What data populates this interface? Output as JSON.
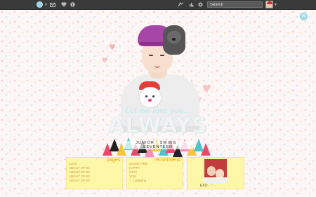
{
  "topbar": {
    "search_placeholder": "Search",
    "icons": [
      "dashboard-logo",
      "mail-icon",
      "heart-icon",
      "info-icon",
      "add-post-icon",
      "settings-icon",
      "help-icon"
    ]
  },
  "header": {
    "tagline": "Let me love you...",
    "big_word": "ALWAYS",
    "sub_line": "JUNIOR · SWING · SEVENTEEN"
  },
  "boxes": {
    "pages": {
      "title": "pages",
      "items": [
        "home",
        "ABOUT OF 01",
        "ABOUT OF 02",
        "ABOUT OF 03",
        "ABOUT OF 04"
      ]
    },
    "recommend": {
      "title": "recommend",
      "items": [
        "SHOW TIME",
        "HAPPY",
        "STAY",
        "YOU",
        "♡ Lalabeng"
      ]
    },
    "profile": {
      "caption": "EXO · ♡ ·"
    }
  },
  "colors": {
    "topbar": "#3a3a3a",
    "box_bg": "#fff7a8",
    "box_title": "#e0a400",
    "accent_blue": "#9fd6e6"
  }
}
